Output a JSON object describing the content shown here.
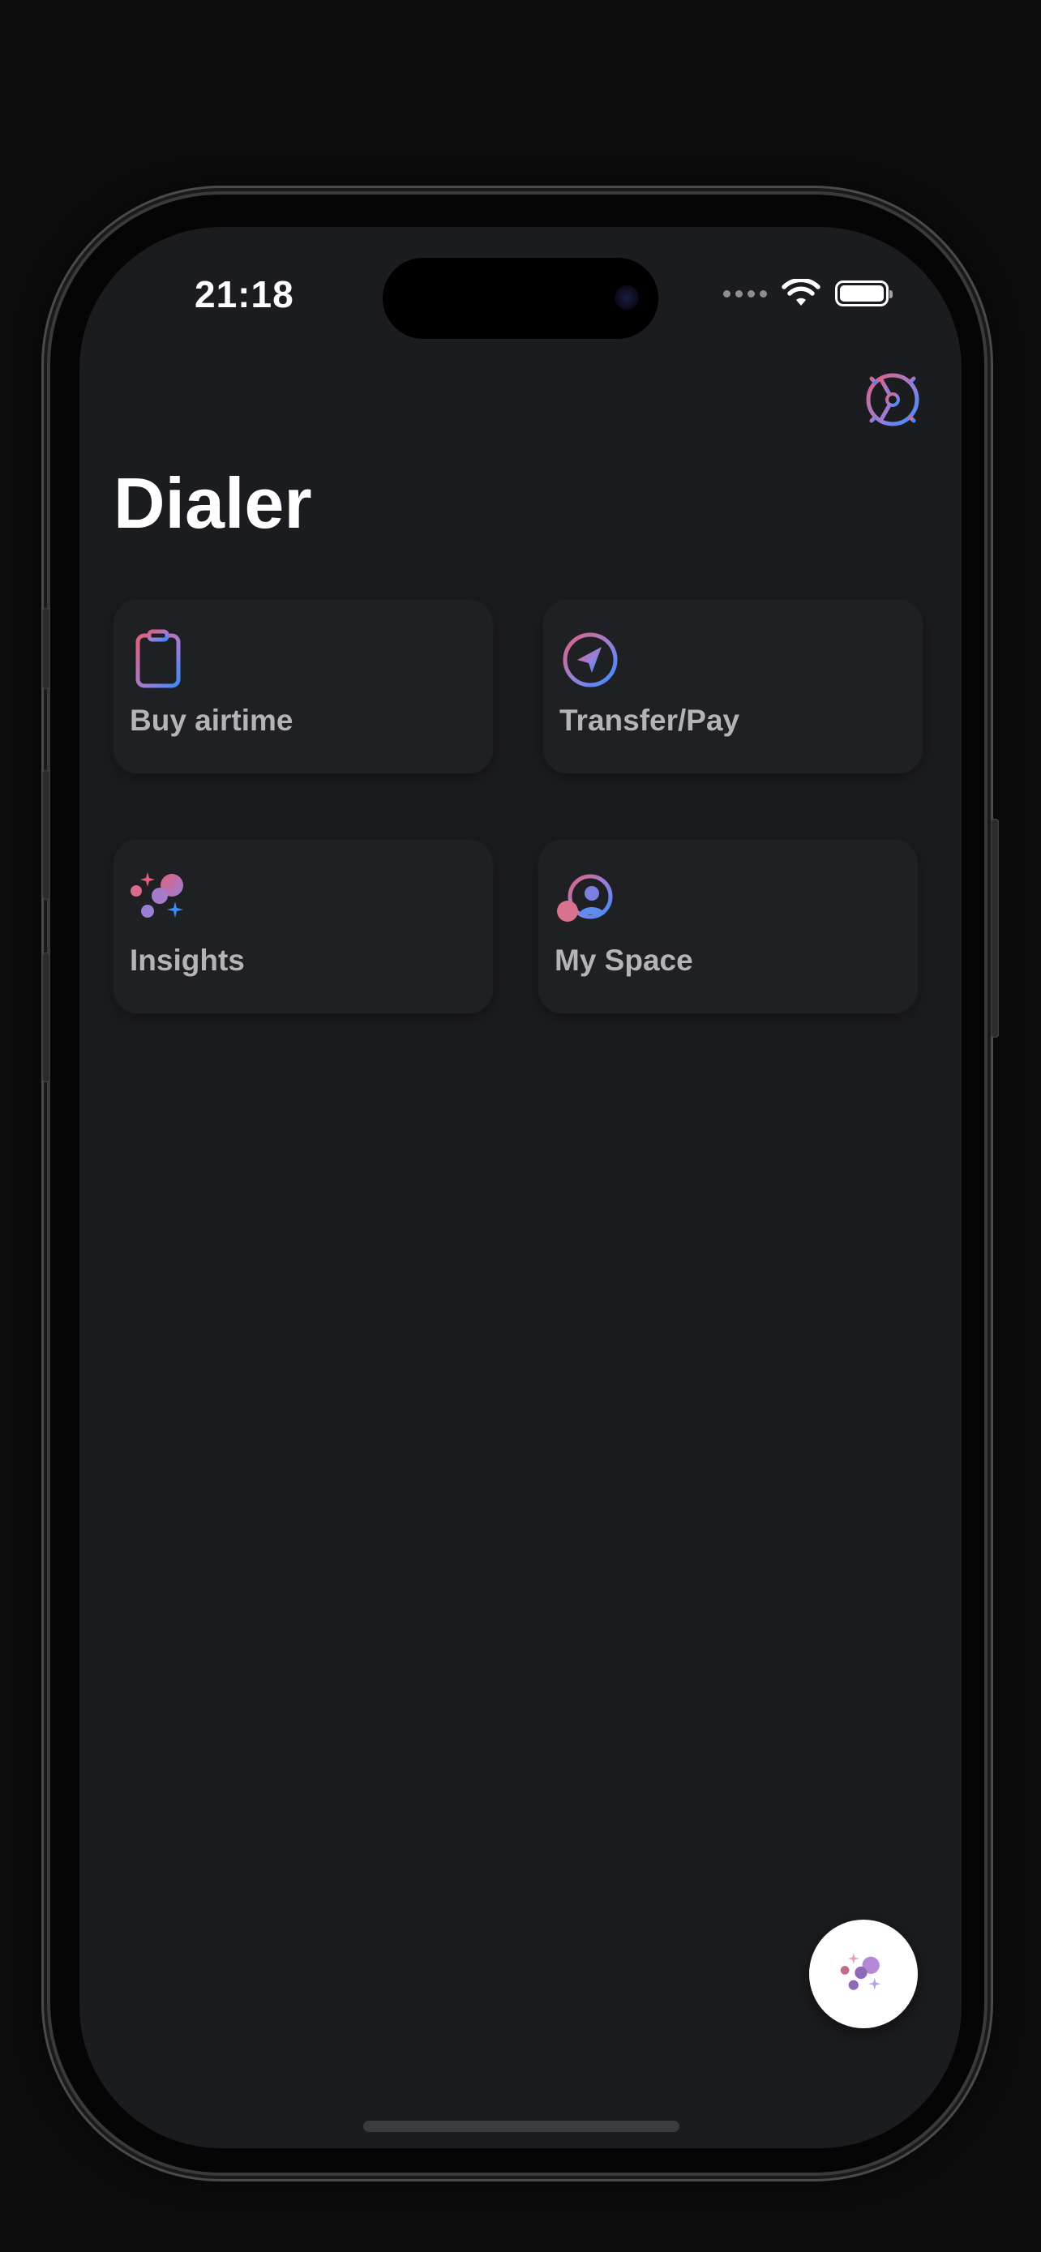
{
  "status_bar": {
    "time": "21:18",
    "signal_icon": "cellular-dots-icon",
    "wifi_icon": "wifi-icon",
    "battery_icon": "battery-full-icon"
  },
  "header": {
    "title": "Dialer",
    "settings_icon": "gear-clock-icon"
  },
  "cards": [
    {
      "label": "Buy airtime",
      "icon": "clipboard-icon"
    },
    {
      "label": "Transfer/Pay",
      "icon": "send-arrow-icon"
    },
    {
      "label": "Insights",
      "icon": "sparkle-bubbles-icon"
    },
    {
      "label": "My Space",
      "icon": "user-profile-icon"
    }
  ],
  "fab": {
    "icon": "sparkle-bubbles-icon"
  },
  "colors": {
    "background": "#1b1c1f",
    "card": "#1f2023",
    "title": "#ffffff",
    "card_label": "#b3b3b8",
    "gradient_pink": "#e0607e",
    "gradient_purple": "#9b7fd6",
    "gradient_blue": "#3a8bff"
  }
}
